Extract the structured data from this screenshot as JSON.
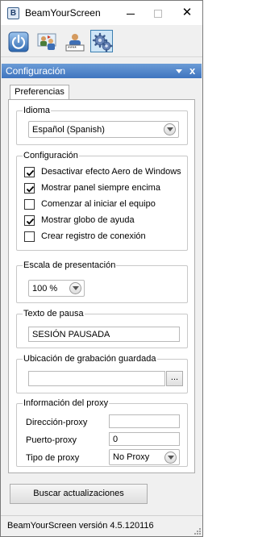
{
  "window": {
    "title": "BeamYourScreen",
    "app_icon_letter": "B"
  },
  "toolbar": {
    "buttons": [
      {
        "name": "power-icon",
        "selected": false
      },
      {
        "name": "share-screen-icon",
        "selected": false
      },
      {
        "name": "join-session-icon",
        "selected": false
      },
      {
        "name": "settings-gear-icon",
        "selected": true
      }
    ]
  },
  "panel": {
    "title": "Configuración",
    "pin_icon": "triangle-down-icon",
    "close_label": "x"
  },
  "tabs": [
    {
      "label": "Preferencias",
      "active": true
    }
  ],
  "idioma": {
    "label": "Idioma",
    "selected": "Español (Spanish)"
  },
  "configuracion": {
    "label": "Configuración",
    "options": [
      {
        "label": "Desactivar efecto Aero de Windows",
        "checked": true
      },
      {
        "label": "Mostrar panel siempre encima",
        "checked": true
      },
      {
        "label": "Comenzar al iniciar el equipo",
        "checked": false
      },
      {
        "label": "Mostrar globo de ayuda",
        "checked": true
      },
      {
        "label": "Crear registro de conexión",
        "checked": false
      }
    ]
  },
  "escala": {
    "label": "Escala de presentación",
    "selected": "100 %"
  },
  "pausa": {
    "label": "Texto de pausa",
    "value": "SESIÓN PAUSADA"
  },
  "grabacion": {
    "label": "Ubicación de grabación guardada",
    "value": "",
    "browse_label": "..."
  },
  "proxy": {
    "label": "Información del proxy",
    "direccion_label": "Dirección-proxy",
    "direccion_value": "",
    "puerto_label": "Puerto-proxy",
    "puerto_value": "0",
    "tipo_label": "Tipo de proxy",
    "tipo_selected": "No Proxy"
  },
  "actions": {
    "check_updates_label": "Buscar actualizaciones"
  },
  "status": {
    "version_text": "BeamYourScreen versión 4.5.120116"
  },
  "colors": {
    "panel_header": "#3f75bf",
    "selected_tool": "#cfe6f7"
  }
}
